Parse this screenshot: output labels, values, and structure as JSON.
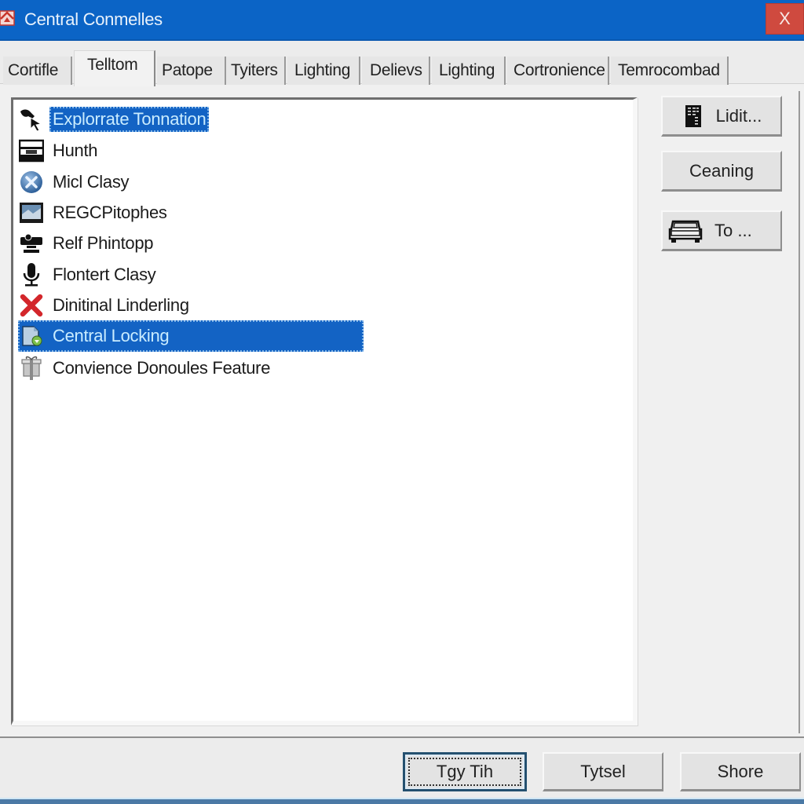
{
  "window": {
    "title": "Central Conmelles",
    "close_label": "X",
    "accent_color": "#0b64c6",
    "close_color": "#cf4a3f"
  },
  "tabs": [
    {
      "label": "Cortifle",
      "active": false
    },
    {
      "label": "Telltom",
      "active": true
    },
    {
      "label": "Patope",
      "active": false
    },
    {
      "label": "Tyiters",
      "active": false
    },
    {
      "label": "Lighting",
      "active": false
    },
    {
      "label": "Delievs",
      "active": false
    },
    {
      "label": "Lighting",
      "active": false
    },
    {
      "label": "Cortronience",
      "active": false
    },
    {
      "label": "Temrocombad",
      "active": false
    }
  ],
  "list": {
    "selection_color": "#1363c4",
    "items": [
      {
        "label": "Explorrate Tonnation",
        "icon": "cursor-hand-icon",
        "selected": true
      },
      {
        "label": "Hunth",
        "icon": "printer-icon",
        "selected": false
      },
      {
        "label": "Micl Clasy",
        "icon": "blue-x-circle-icon",
        "selected": false
      },
      {
        "label": "REGCPitophes",
        "icon": "monitor-picture-icon",
        "selected": false
      },
      {
        "label": "Relf Phintopp",
        "icon": "webcam-icon",
        "selected": false
      },
      {
        "label": "Flontert Clasy",
        "icon": "microphone-icon",
        "selected": false
      },
      {
        "label": "Dinitinal Linderling",
        "icon": "red-x-icon",
        "selected": false
      },
      {
        "label": "Central Locking",
        "icon": "document-lock-icon",
        "selected": true
      },
      {
        "label": "Convience Donoules Feature",
        "icon": "gift-box-icon",
        "selected": false
      }
    ]
  },
  "side_buttons": [
    {
      "label": "Lidit...",
      "icon": "building-icon"
    },
    {
      "label": "Ceaning",
      "icon": null
    },
    {
      "label": "To ...",
      "icon": "car-front-icon"
    }
  ],
  "bottom_buttons": [
    {
      "label": "Tgy Tih",
      "default": true
    },
    {
      "label": "Tytsel",
      "default": false
    },
    {
      "label": "Shore",
      "default": false
    }
  ]
}
